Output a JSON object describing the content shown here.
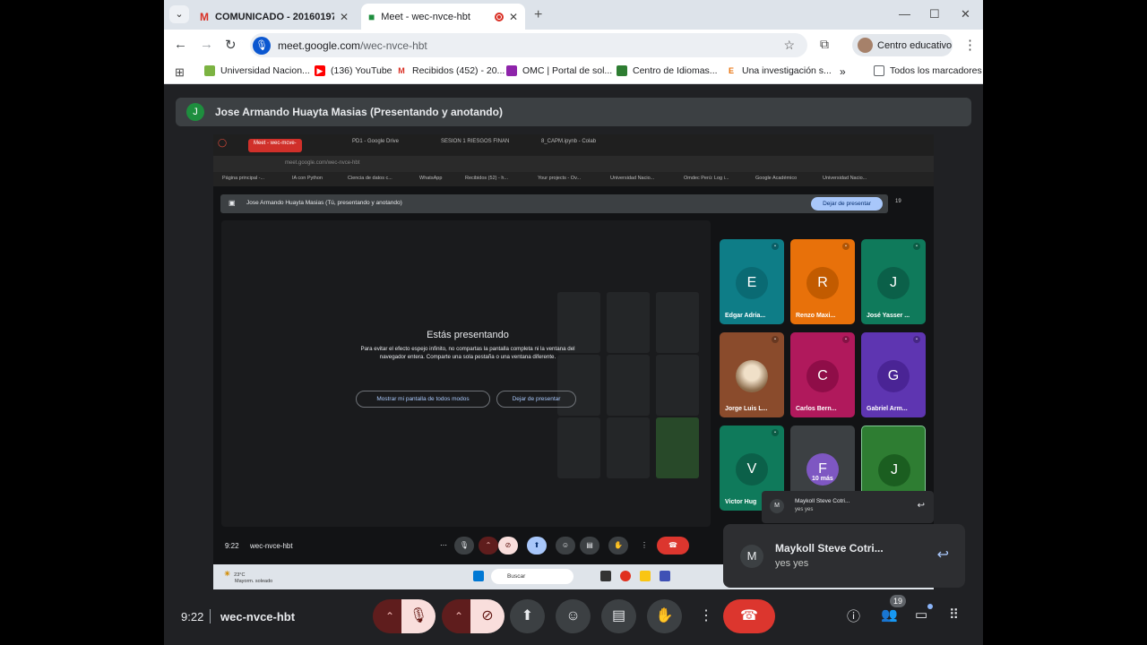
{
  "browser": {
    "tab_menu_icon": "chevron-down-icon",
    "tabs": [
      {
        "label": "COMUNICADO - 20160197@lar",
        "icon": "gmail-icon"
      },
      {
        "label": "Meet - wec-nvce-hbt",
        "icon": "meet-icon"
      }
    ],
    "url_host": "meet.google.com",
    "url_path": "/wec-nvce-hbt",
    "profile_label": "Centro educativo",
    "bookmarks": [
      "Universidad Nacion...",
      "(136) YouTube",
      "Recibidos (452) - 20...",
      "OMC | Portal de sol...",
      "Centro de Idiomas...",
      "Una investigación s...",
      "Todos los marcadores"
    ]
  },
  "meet": {
    "presenter_initial": "J",
    "presenter_banner": "Jose Armando Huayta Masias (Presentando y anotando)",
    "time": "9:22",
    "meeting_code": "wec-nvce-hbt",
    "participants_count": "19",
    "accent": "#dc362e"
  },
  "shared": {
    "tabs": [
      "Meet - wec-mcve-",
      "PD1 - Google Drive",
      "SESION 1 RIESGOS FINAN",
      "8_CAPM.ipynb - Colab"
    ],
    "address": "meet.google.com/wec-nvce-hbt",
    "bookmarks": [
      "Página principal -...",
      "IA con Python",
      "Ciencia de datos c...",
      "WhatsApp",
      "Recibidos (52) - h...",
      "Your projects - Ov...",
      "Universidad Nacio...",
      "Omdec Perú: Log i...",
      "Google Académico",
      "Universidad Nacio..."
    ],
    "presenter_banner": "Jose Armando Huayta Masias (Tú, presentando y anotando)",
    "stop_label": "Dejar de presentar",
    "count": "19",
    "presenting_title": "Estás presentando",
    "presenting_desc": "Para evitar el efecto espejo infinito, no compartas la pantalla completa ni la ventana del navegador entera. Comparte una sola pestaña o una ventana diferente.",
    "show_anyway": "Mostrar mi pantalla de todos modos",
    "stop_presenting": "Dejar de presentar",
    "tiles": [
      {
        "initial": "E",
        "name": "Edgar Adria...",
        "bg": "#0e7d87",
        "av": "#0a6a73"
      },
      {
        "initial": "R",
        "name": "Renzo Maxi...",
        "bg": "#e8710a",
        "av": "#c25b00"
      },
      {
        "initial": "J",
        "name": "José Yasser ...",
        "bg": "#0f7a5b",
        "av": "#0b6049"
      },
      {
        "initial": "",
        "name": "Jorge Luis L...",
        "bg": "#8a4b2c",
        "av": "#d4b896"
      },
      {
        "initial": "C",
        "name": "Carlos Bern...",
        "bg": "#b0195c",
        "av": "#8f0d48"
      },
      {
        "initial": "G",
        "name": "Gabriel Arm...",
        "bg": "#5e35b1",
        "av": "#4a2495"
      },
      {
        "initial": "V",
        "name": "Victor Hug",
        "bg": "#0f7a5b",
        "av": "#0b6049"
      },
      {
        "initial": "F",
        "name": "10 más",
        "bg": "#3c4043",
        "av": "#7e57c2"
      },
      {
        "initial": "J",
        "name": "",
        "bg": "#2e7d32",
        "av": "#1b5e20"
      }
    ],
    "chat_sender": "Maykoll Steve Cotri...",
    "chat_body": "yes yes",
    "time": "9:22",
    "code": "wec-nvce-hbt",
    "weather_temp": "23°C",
    "weather_desc": "Mayorm. soleado",
    "taskbar_search": "Buscar"
  },
  "chat_toast": {
    "initial": "M",
    "sender": "Maykoll Steve Cotri...",
    "body": "yes yes"
  }
}
